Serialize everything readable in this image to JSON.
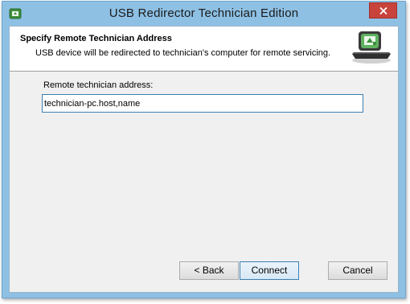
{
  "window": {
    "title": "USB Redirector Technician Edition"
  },
  "header": {
    "title": "Specify Remote Technician Address",
    "subtitle": "USB device will be redirected to technician's computer for remote servicing."
  },
  "form": {
    "address_label": "Remote technician address:",
    "address_value": "technician-pc.host,name"
  },
  "buttons": {
    "back": "< Back",
    "connect": "Connect",
    "cancel": "Cancel"
  },
  "icons": {
    "app": "usb-redirector-app-icon",
    "close": "close-icon",
    "header_graphic": "computer-usb-device-icon"
  },
  "colors": {
    "frame": "#8ec0e4",
    "close_button": "#c7433c",
    "input_border": "#3c7fb1"
  }
}
